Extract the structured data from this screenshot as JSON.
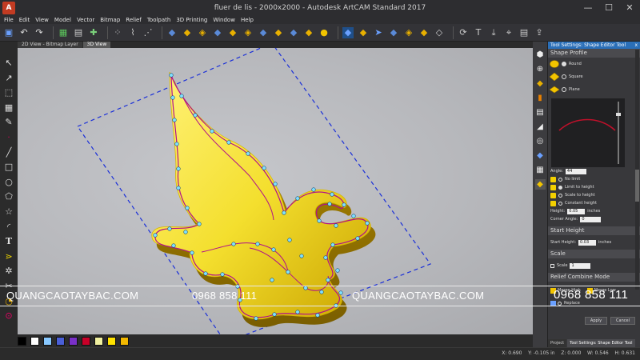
{
  "window": {
    "title": "fluer de lis - 2000x2000 - Autodesk ArtCAM Standard 2017",
    "minimize": "—",
    "maximize": "☐",
    "close": "✕"
  },
  "menu": [
    "File",
    "Edit",
    "View",
    "Model",
    "Vector",
    "Bitmap",
    "Relief",
    "Toolpath",
    "3D Printing",
    "Window",
    "Help"
  ],
  "tabs": [
    "2D View - Bitmap Layer",
    "3D View"
  ],
  "active_tab": "3D View",
  "panel": {
    "header": "Tool Settings: Shape Editor Tool",
    "close": "x",
    "shape_profile_title": "Shape Profile",
    "shapes": [
      {
        "label": "Round",
        "selected": true
      },
      {
        "label": "Square",
        "selected": false
      },
      {
        "label": "Plane",
        "selected": false
      }
    ],
    "angle_label": "Angle:",
    "angle_value": "44",
    "height_modes": [
      {
        "label": "No limit",
        "selected": false
      },
      {
        "label": "Limit to height",
        "selected": true
      },
      {
        "label": "Scale to height",
        "selected": false
      },
      {
        "label": "Constant height",
        "selected": false
      }
    ],
    "height_label": "Height:",
    "height_value": "0.05",
    "height_unit": "inches",
    "corner_angle_label": "Corner Angle:",
    "corner_angle_value": "0",
    "start_height_title": "Start Height",
    "start_height_label": "Start Height:",
    "start_height_value": "0.03",
    "start_height_unit": "inches",
    "scale_title": "Scale",
    "scale_label": "Scale",
    "scale_value": "1",
    "relief_combine_title": "Relief Combine Mode",
    "combine_modes": [
      "Merge High",
      "Merge Low"
    ],
    "replace_label": "Replace",
    "apply_label": "Apply",
    "cancel_label": "Cancel",
    "bottom_tabs": [
      "Project",
      "Tool Settings: Shape Editor Tool"
    ]
  },
  "status": {
    "coords": "X: 0.690    Y: -0.105 in    Z: 0.000    W: 0.546    H: 0.631"
  },
  "palette": [
    "#000000",
    "#ffffff",
    "#88c8ff",
    "#4a5fd8",
    "#7a30c8",
    "#c80028",
    "#f0f0a0",
    "#ffe200",
    "#f2b800"
  ],
  "watermark": {
    "site_left": "QUANGCAOTAYBAC.COM",
    "phone_left": "0968 858 111",
    "site_right": "QUANGCAOTAYBAC.COM",
    "phone_right": "0968 858 111"
  }
}
